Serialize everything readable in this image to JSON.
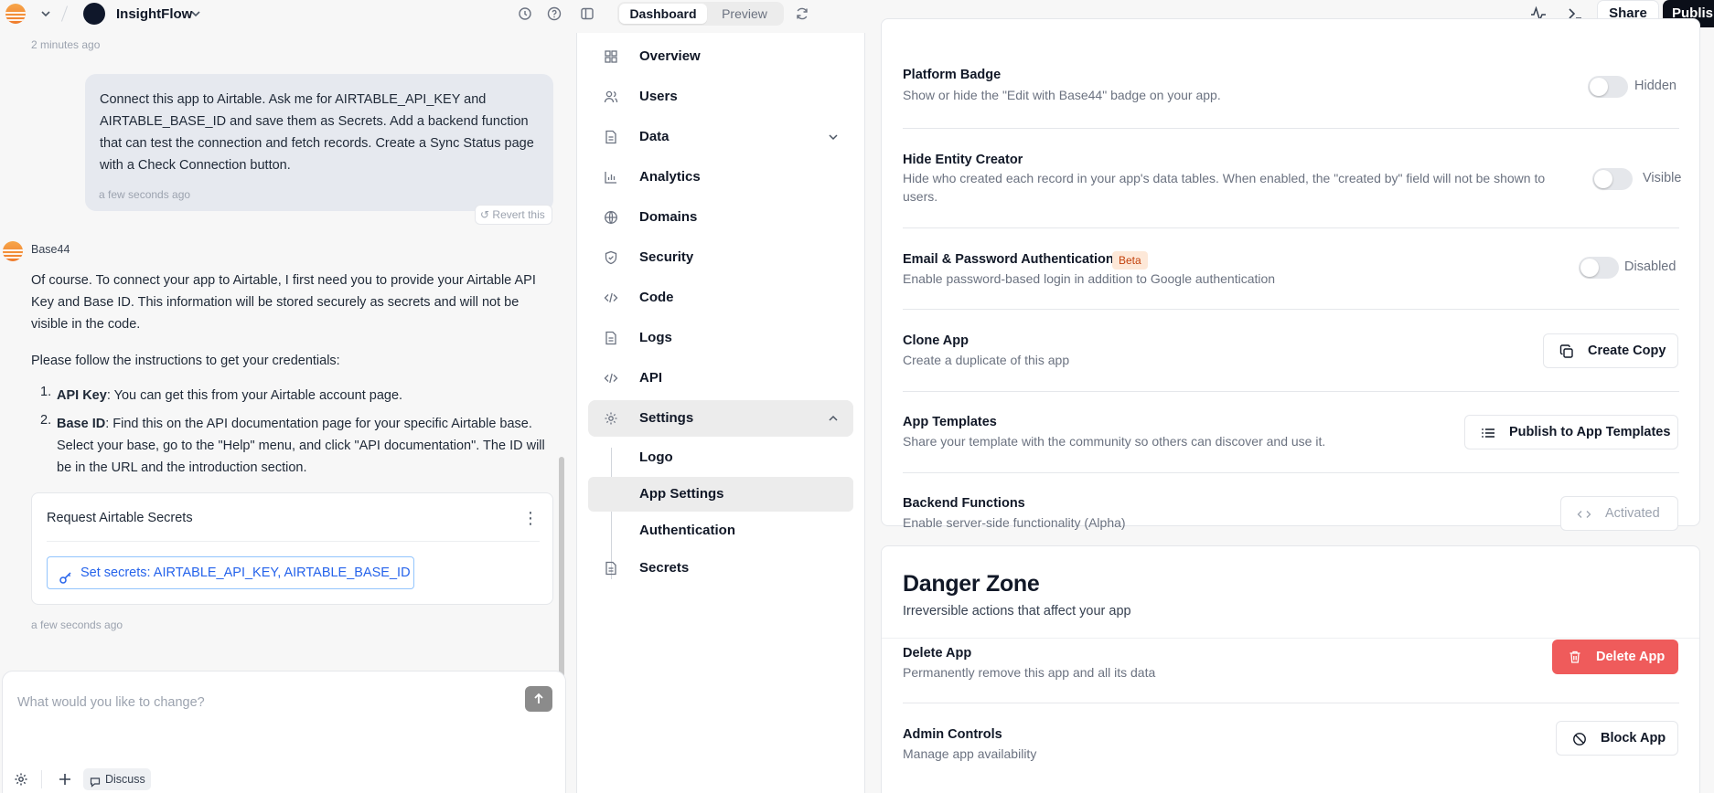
{
  "topbar": {
    "project_name": "InsightFlow",
    "tabs": [
      "Dashboard",
      "Preview"
    ],
    "share_label": "Share",
    "publish_label": "Publish"
  },
  "chat": {
    "time_top": "2 minutes ago",
    "user_message": "Connect this app to Airtable. Ask me for AIRTABLE_API_KEY and AIRTABLE_BASE_ID and save them as Secrets. Add a backend function that can test the connection and fetch records. Create a Sync Status page with a Check Connection button.",
    "user_time": "a few seconds ago",
    "revert_label": "Revert this",
    "bot_name": "Base44",
    "bot_para1": "Of course. To connect your app to Airtable, I first need you to provide your Airtable API Key and Base ID. This information will be stored securely as secrets and will not be visible in the code.",
    "bot_para2": "Please follow the instructions to get your credentials:",
    "list": [
      {
        "num": "1.",
        "bold": "API Key",
        "text": ": You can get this from your Airtable account page."
      },
      {
        "num": "2.",
        "bold": "Base ID",
        "text": ": Find this on the API documentation page for your specific Airtable base. Select your base, go to the \"Help\" menu, and click \"API documentation\". The ID will be in the URL and the introduction section."
      }
    ],
    "card_title": "Request Airtable Secrets",
    "card_button": "Set secrets: AIRTABLE_API_KEY, AIRTABLE_BASE_ID",
    "bot_time": "a few seconds ago",
    "composer_placeholder": "What would you like to change?",
    "discuss_label": "Discuss"
  },
  "nav": {
    "items": [
      {
        "label": "Overview",
        "icon": "grid-icon"
      },
      {
        "label": "Users",
        "icon": "users-icon"
      },
      {
        "label": "Data",
        "icon": "file-icon"
      },
      {
        "label": "Analytics",
        "icon": "bar-chart-icon"
      },
      {
        "label": "Domains",
        "icon": "globe-icon"
      },
      {
        "label": "Security",
        "icon": "shield-icon"
      },
      {
        "label": "Code",
        "icon": "code-icon"
      },
      {
        "label": "Logs",
        "icon": "file-icon"
      },
      {
        "label": "API",
        "icon": "code-icon"
      },
      {
        "label": "Settings",
        "icon": "gear-icon"
      }
    ],
    "sub_items": [
      "Logo",
      "App Settings",
      "Authentication"
    ],
    "secrets_label": "Secrets"
  },
  "settings": {
    "rows": [
      {
        "title": "Platform Badge",
        "desc": "Show or hide the \"Edit with Base44\" badge on your app.",
        "toggle_label": "Hidden"
      },
      {
        "title": "Hide Entity Creator",
        "desc": "Hide who created each record in your app's data tables. When enabled, the \"created by\" field will not be shown to users.",
        "toggle_label": "Visible"
      },
      {
        "title": "Email & Password Authentication",
        "badge": "Beta",
        "desc": "Enable password-based login in addition to Google authentication",
        "toggle_label": "Disabled"
      },
      {
        "title": "Clone App",
        "desc": "Create a duplicate of this app",
        "button": "Create Copy"
      },
      {
        "title": "App Templates",
        "desc": "Share your template with the community so others can discover and use it.",
        "button": "Publish to App Templates"
      },
      {
        "title": "Backend Functions",
        "desc": "Enable server-side functionality (Alpha)",
        "button": "Activated"
      }
    ],
    "danger": {
      "title": "Danger Zone",
      "subtitle": "Irreversible actions that affect your app",
      "rows": [
        {
          "title": "Delete App",
          "desc": "Permanently remove this app and all its data",
          "button": "Delete App"
        },
        {
          "title": "Admin Controls",
          "desc": "Manage app availability",
          "button": "Block App"
        }
      ]
    }
  },
  "colors": {
    "accent_blue": "#2563eb",
    "danger_red": "#ef5b5b",
    "beta_orange": "#c2410c",
    "publish_black": "#0b0f19"
  }
}
